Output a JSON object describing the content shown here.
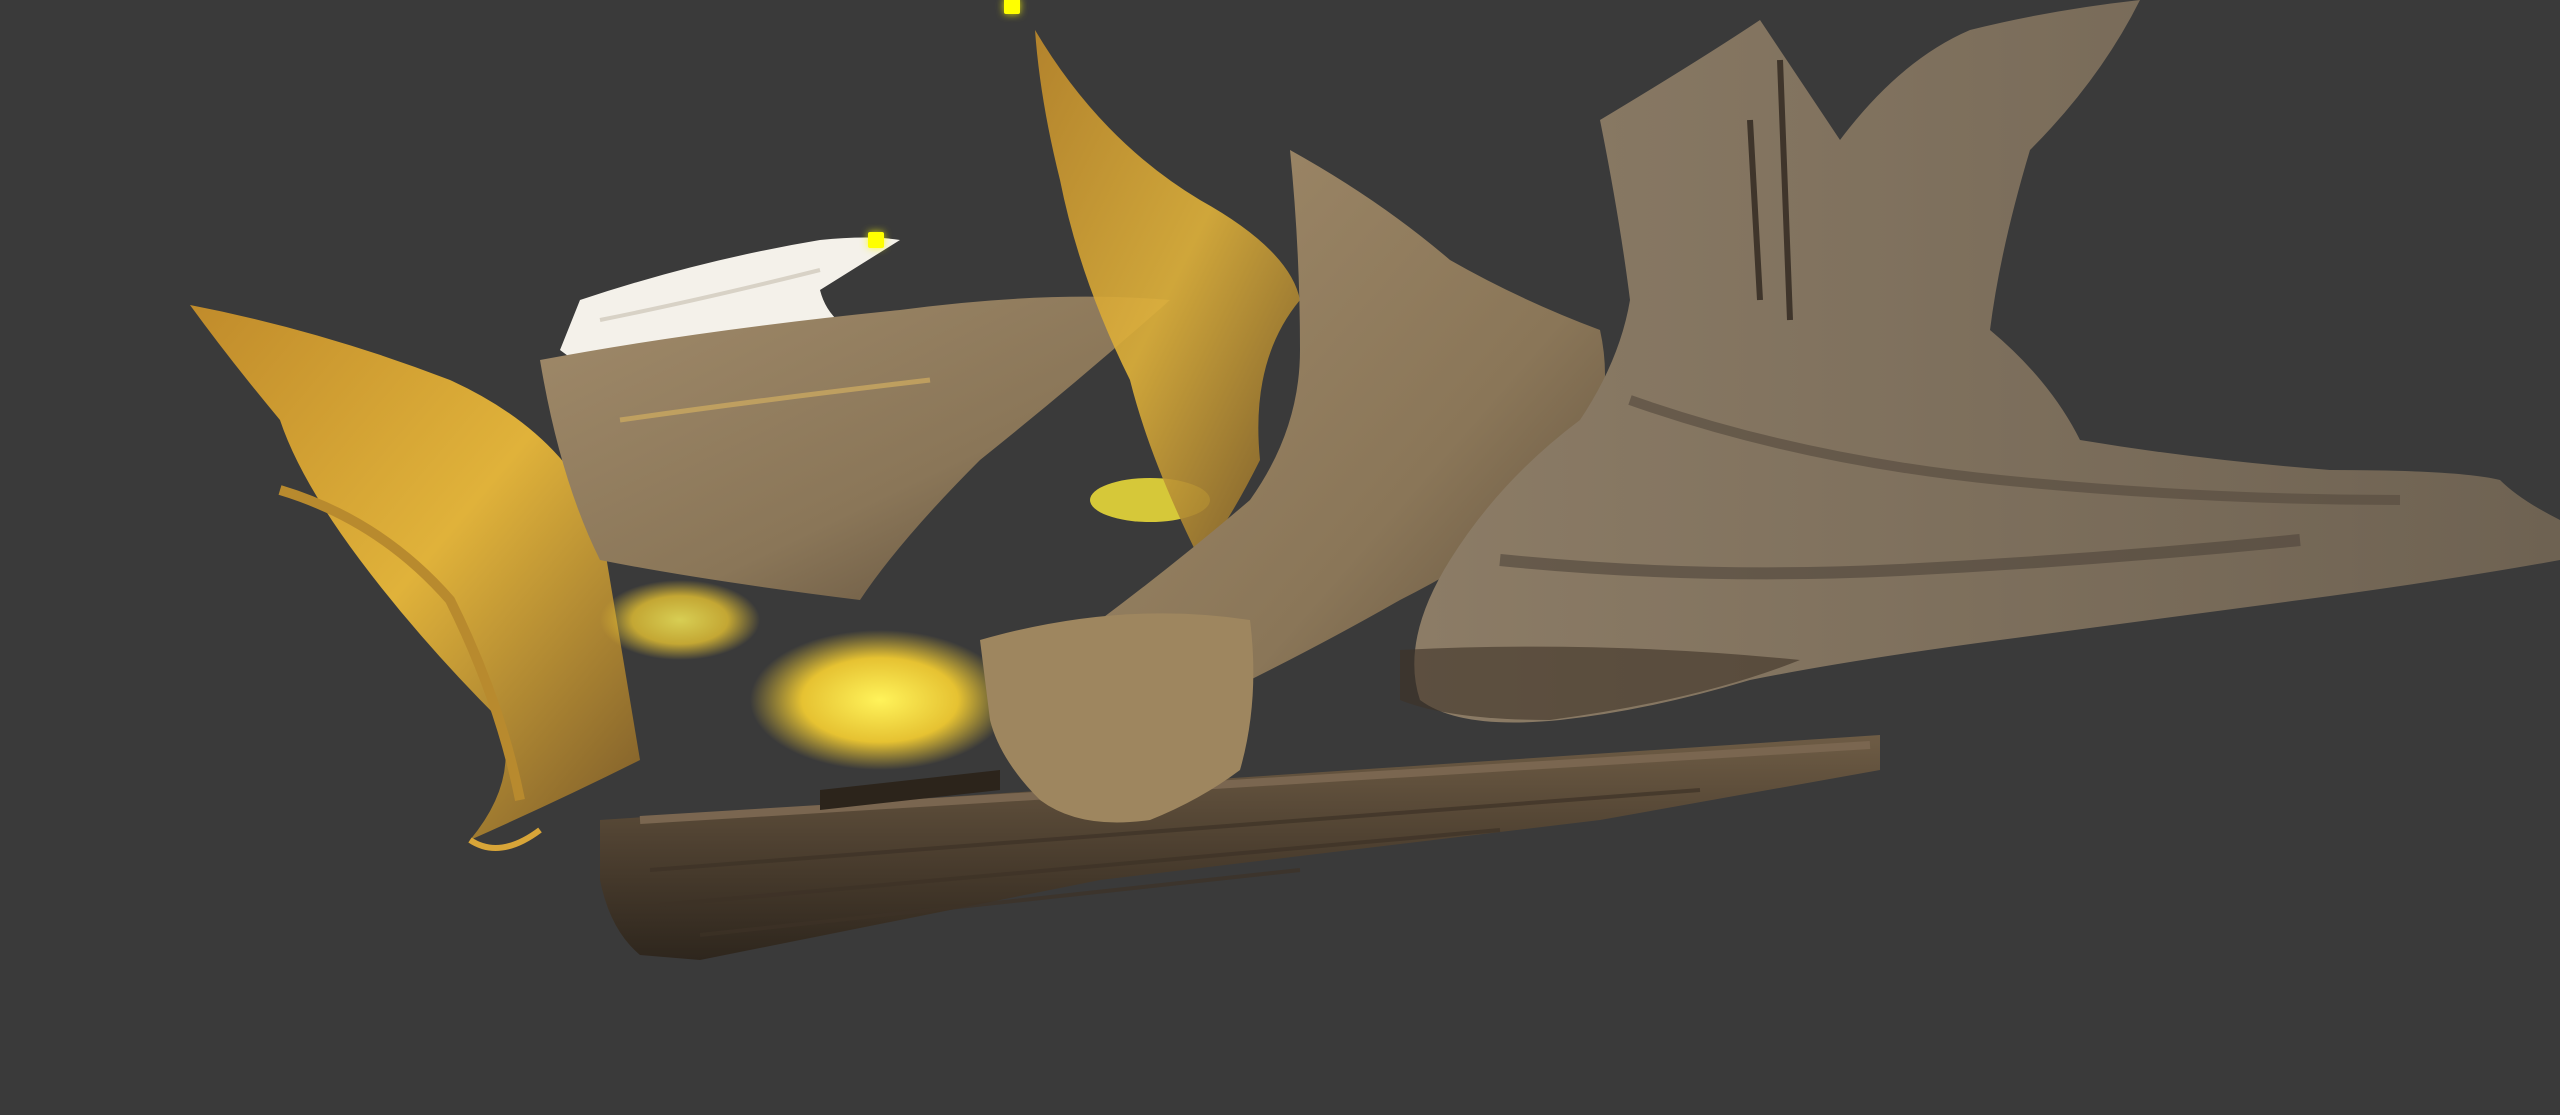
{
  "viewport": {
    "background_color": "#3a3a3a",
    "model_name": "burning-ghost-ship-model",
    "texture_colors": {
      "hull_dark": "#4a3d2e",
      "hull_mid": "#6e5c45",
      "drape_light": "#a08a6a",
      "drape_mid": "#8a7658",
      "drape_shadow": "#3d3226",
      "glow_gold": "#e0b23a",
      "glow_yellow": "#f2e23a",
      "sail_white": "#f4f1ea"
    },
    "light_markers": [
      {
        "name": "light-marker-top",
        "color": "#ffff00"
      },
      {
        "name": "light-marker-sail",
        "color": "#ffff00"
      }
    ]
  }
}
